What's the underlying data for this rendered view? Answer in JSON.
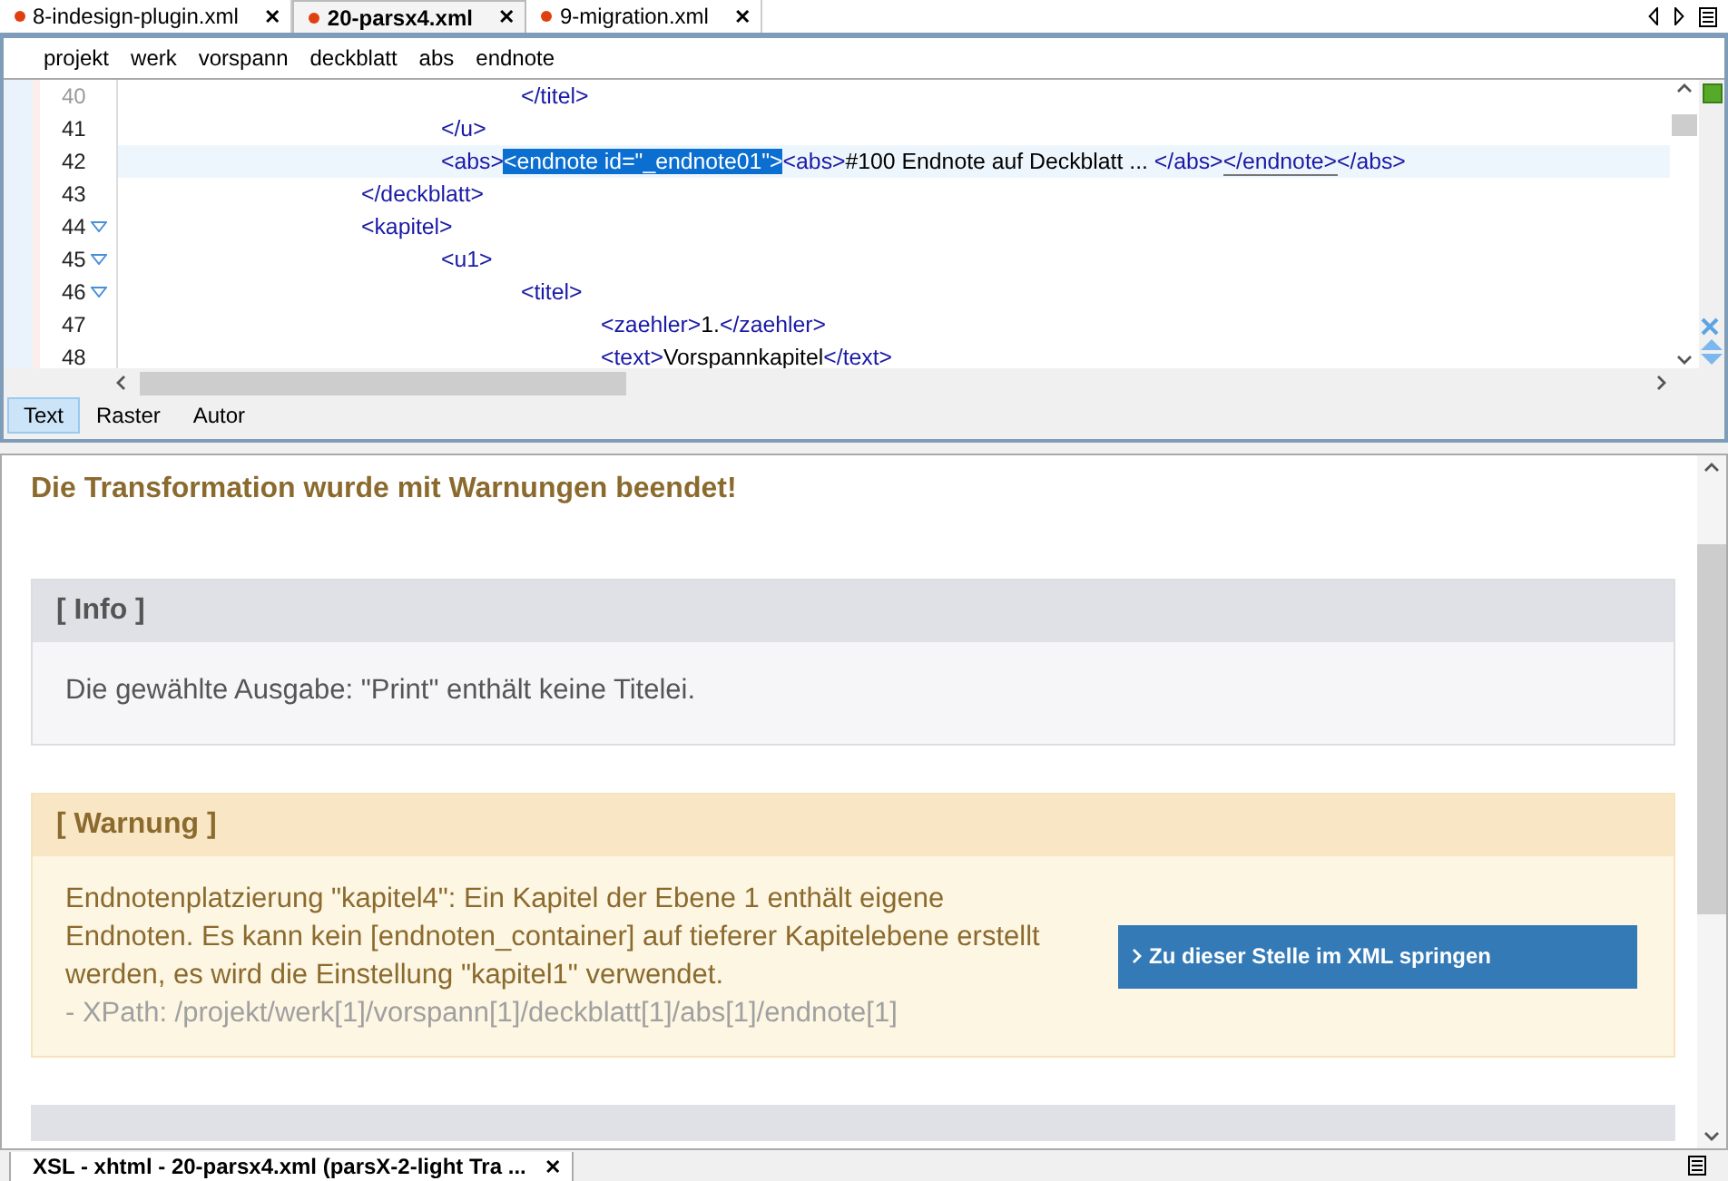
{
  "file_tabs": [
    {
      "label": "8-indesign-plugin.xml",
      "selected": false,
      "close": "✕"
    },
    {
      "label": "20-parsx4.xml",
      "selected": true,
      "close": "✕"
    },
    {
      "label": "9-migration.xml",
      "selected": false,
      "close": "✕"
    }
  ],
  "breadcrumb": [
    "projekt",
    "werk",
    "vorspann",
    "deckblatt",
    "abs",
    "endnote"
  ],
  "editor": {
    "lines": [
      {
        "number": "40",
        "foldable": false,
        "current": false,
        "segments": [
          {
            "kind": "tag",
            "text": "\t\t\t\t\t</titel>",
            "selected": false
          }
        ]
      },
      {
        "number": "41",
        "foldable": false,
        "current": false,
        "segments": [
          {
            "kind": "tag",
            "text": "\t\t\t\t</u>",
            "selected": false
          }
        ]
      },
      {
        "number": "42",
        "foldable": false,
        "current": true,
        "segments": [
          {
            "kind": "tag",
            "text": "\t\t\t\t<abs>",
            "selected": false
          },
          {
            "kind": "tag",
            "text": "<endnote id=\"_endnote01\">",
            "selected": true
          },
          {
            "kind": "tag",
            "text": "<abs>",
            "selected": false
          },
          {
            "kind": "text",
            "text": "#100 Endnote auf Deckblatt ... ",
            "selected": false
          },
          {
            "kind": "tag",
            "text": "</abs>",
            "selected": false
          },
          {
            "kind": "match",
            "text": "</endnote>",
            "selected": false
          },
          {
            "kind": "tag",
            "text": "</abs>",
            "selected": false
          }
        ]
      },
      {
        "number": "43",
        "foldable": false,
        "current": false,
        "segments": [
          {
            "kind": "tag",
            "text": "\t\t\t</deckblatt>",
            "selected": false
          }
        ]
      },
      {
        "number": "44",
        "foldable": true,
        "current": false,
        "segments": [
          {
            "kind": "tag",
            "text": "\t\t\t<kapitel>",
            "selected": false
          }
        ]
      },
      {
        "number": "45",
        "foldable": true,
        "current": false,
        "segments": [
          {
            "kind": "tag",
            "text": "\t\t\t\t<u1>",
            "selected": false
          }
        ]
      },
      {
        "number": "46",
        "foldable": true,
        "current": false,
        "segments": [
          {
            "kind": "tag",
            "text": "\t\t\t\t\t<titel>",
            "selected": false
          }
        ]
      },
      {
        "number": "47",
        "foldable": false,
        "current": false,
        "segments": [
          {
            "kind": "tag",
            "text": "\t\t\t\t\t\t<zaehler>",
            "selected": false
          },
          {
            "kind": "text",
            "text": "1.",
            "selected": false
          },
          {
            "kind": "tag",
            "text": "</zaehler>",
            "selected": false
          }
        ]
      },
      {
        "number": "48",
        "foldable": false,
        "current": false,
        "segments": [
          {
            "kind": "tag",
            "text": "\t\t\t\t\t\t<text>",
            "selected": false
          },
          {
            "kind": "text",
            "text": "Vorspannkapitel",
            "selected": false
          },
          {
            "kind": "tag",
            "text": "</text>",
            "selected": false
          }
        ]
      }
    ]
  },
  "mode_tabs": [
    {
      "label": "Text",
      "selected": true
    },
    {
      "label": "Raster",
      "selected": false
    },
    {
      "label": "Autor",
      "selected": false
    }
  ],
  "report": {
    "heading": "Die Transformation wurde mit Warnungen beendet!",
    "messages": [
      {
        "kind": "info",
        "title": "[ Info ]",
        "lines": [
          "Die gewählte Ausgabe: \"Print\" enthält keine Titelei."
        ]
      },
      {
        "kind": "warning",
        "title": "[ Warnung ]",
        "text": "Endnotenplatzierung \"kapitel4\": Ein Kapitel der Ebene 1 enthält eigene Endnoten. Es kann kein [endnoten_container] auf tieferer Kapitelebene erstellt werden, es wird die Einstellung \"kapitel1\" verwendet.",
        "xpath": "- XPath: /projekt/werk[1]/vorspann[1]/deckblatt[1]/abs[1]/endnote[1]",
        "button": "Zu dieser Stelle im XML springen"
      }
    ]
  },
  "bottom_tab": {
    "label": "XSL - xhtml - 20-parsx4.xml (parsX-2-light Tra ...",
    "close": "✕"
  }
}
